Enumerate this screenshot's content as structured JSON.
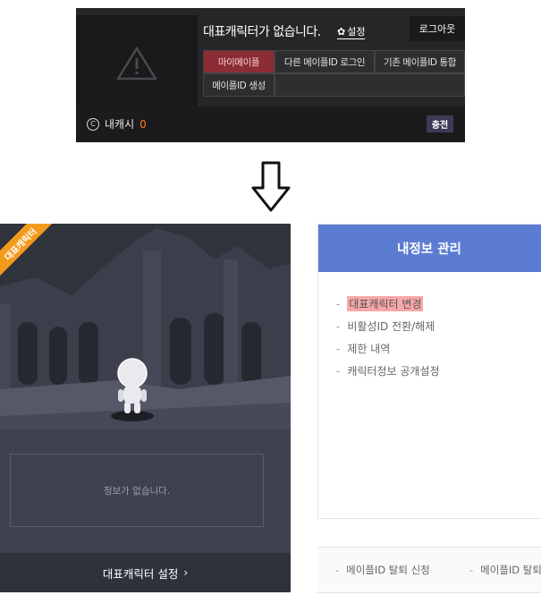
{
  "top_panel": {
    "title": "대표캐릭터가 없습니다.",
    "settings_label": "설정",
    "logout_label": "로그아웃",
    "buttons": {
      "my_maple": "마이메이플",
      "other_login": "다른 메이플ID 로그인",
      "merge": "기존 메이플ID 통합",
      "create": "메이플ID 생성"
    },
    "cash_label": "내캐시",
    "cash_value": "0",
    "charge_label": "충전"
  },
  "character_panel": {
    "ribbon_label": "대표캐릭터",
    "info_text": "정보가 없습니다.",
    "set_button_label": "대표캐릭터 설정"
  },
  "info_panel": {
    "header": "내정보 관리",
    "items": [
      {
        "label": "대표캐릭터 변경",
        "highlighted": true
      },
      {
        "label": "비활성ID 전환/해제"
      },
      {
        "label": "제한 내역"
      },
      {
        "label": "캐릭터정보 공개설정"
      }
    ]
  },
  "bottom_links": [
    "메이플ID 탈퇴 신청",
    "메이플ID 탈퇴"
  ],
  "colors": {
    "accent_red": "#8c2c35",
    "cash_orange": "#ff7a1a",
    "ribbon_orange": "#f39a1c",
    "info_header_blue": "#5b7cd1",
    "highlight_pink": "#f6a7a7"
  }
}
